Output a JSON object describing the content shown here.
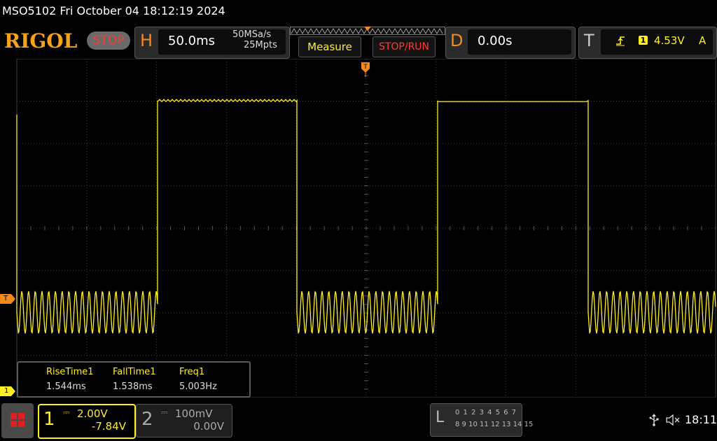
{
  "title_bar": {
    "text": "MSO5102  Fri October 04 18:12:19 2024"
  },
  "brand": {
    "logo": "RIGOL",
    "run_state": "STOP"
  },
  "horizontal": {
    "letter": "H",
    "timebase": "50.0ms",
    "sample_rate": "50MSa/s",
    "memory_depth": "25Mpts"
  },
  "buttons": {
    "measure": "Measure",
    "stop_run": "STOP/RUN"
  },
  "delay": {
    "letter": "D",
    "value": "0.00s"
  },
  "trigger": {
    "letter": "T",
    "source": "1",
    "level": "4.53V",
    "mode": "A",
    "edge_icon": "rising-edge-icon"
  },
  "measurements": [
    {
      "name": "RiseTime1",
      "value": "1.544ms"
    },
    {
      "name": "FallTime1",
      "value": "1.538ms"
    },
    {
      "name": "Freq1",
      "value": "5.003Hz"
    }
  ],
  "channel1": {
    "number": "1",
    "coupling_icon": "dc-coupling-icon",
    "coupling_glyph": "⎓",
    "scale": "2.00V",
    "offset": "-7.84V",
    "color": "#ffee22"
  },
  "channel2": {
    "number": "2",
    "coupling_icon": "dc-coupling-icon",
    "coupling_glyph": "⎓",
    "scale": "100mV",
    "offset": "0.00V",
    "color": "#aaaaaa"
  },
  "logic": {
    "letter": "L",
    "bits_row1": "0 1 2 3  4 5 6 7",
    "bits_row2": "8  9 10 11 12 13 14 15"
  },
  "status": {
    "clock": "18:11"
  },
  "markers": {
    "trigger_level": "T",
    "channel1": "1"
  },
  "waveform": {
    "color": "#ffee22",
    "period_ms": 200,
    "timebase_ms_per_div": 50,
    "volts_per_div": 2.0,
    "high_level_v": 13.5,
    "low_level_v": 3.5,
    "ripple_low_v": 1.0,
    "ripple_high_v": 0.1
  }
}
